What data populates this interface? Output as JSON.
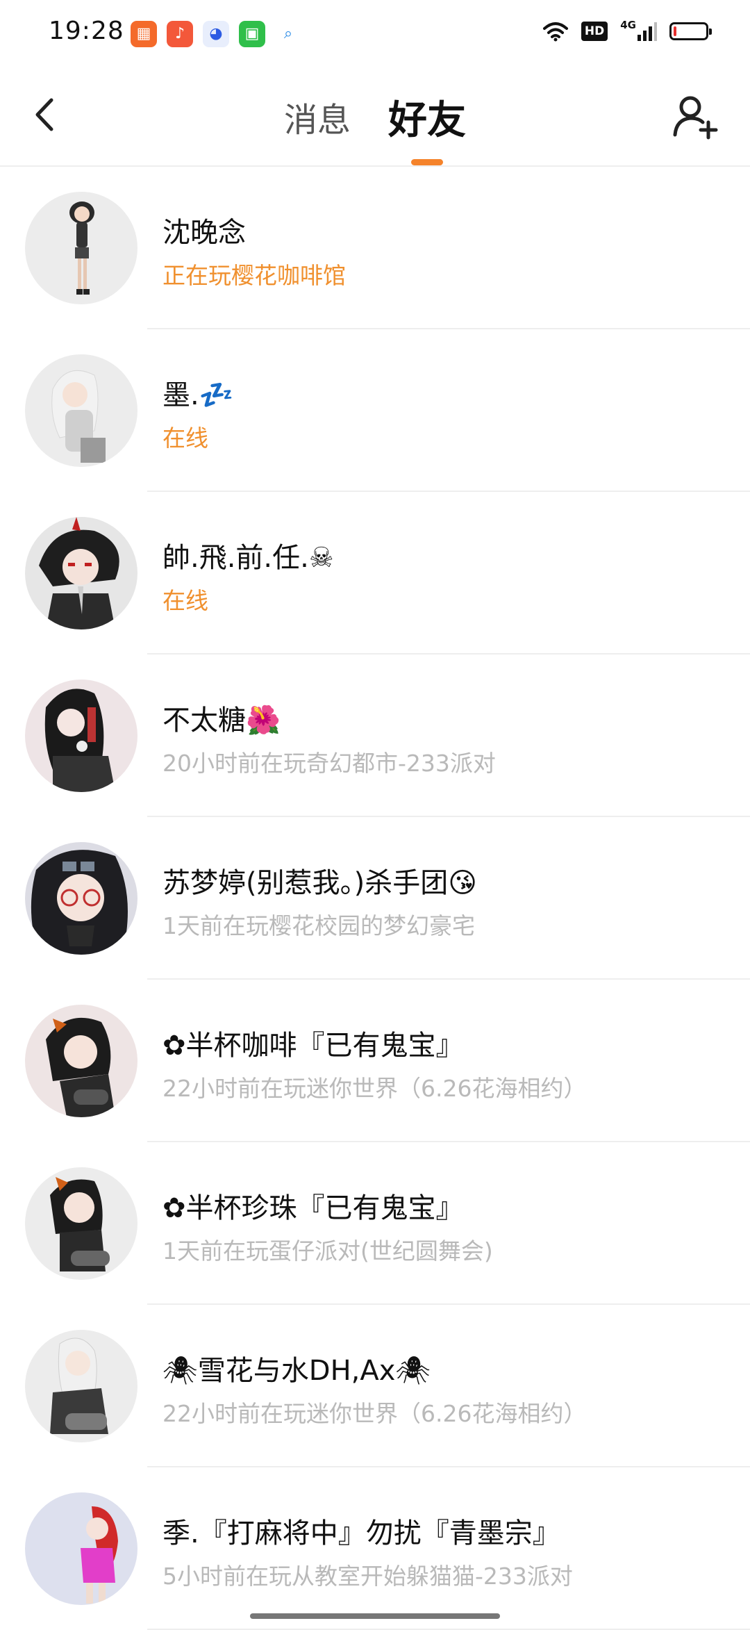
{
  "status_bar": {
    "time": "19:28",
    "hd_label": "HD",
    "net_label": "4G",
    "battery_level": 0.08,
    "battery_color": "#e7302e",
    "notification_apps": [
      "grid-app-icon",
      "music-app-icon",
      "baidu-app-icon",
      "shopping-app-icon",
      "search-app-icon"
    ]
  },
  "header": {
    "tabs": [
      {
        "label": "消息",
        "active": false
      },
      {
        "label": "好友",
        "active": true
      }
    ],
    "accent_color": "#f5832b"
  },
  "friends": [
    {
      "name": "沈晚念",
      "status": "正在玩樱花咖啡馆",
      "online": true,
      "avatar_bg": "#ececec"
    },
    {
      "name": "墨.💤",
      "status": "在线",
      "online": true,
      "avatar_bg": "#ececec"
    },
    {
      "name": "帥.飛.前.任.☠",
      "status": "在线",
      "online": true,
      "avatar_bg": "#e6e6e6"
    },
    {
      "name": "不太糖🌺",
      "status": "20小时前在玩奇幻都市-233派对",
      "online": false,
      "avatar_bg": "#eee4e6"
    },
    {
      "name": "苏梦婷(别惹我。)杀手团😘",
      "status": "1天前在玩樱花校园的梦幻豪宅",
      "online": false,
      "avatar_bg": "#dcdce4"
    },
    {
      "name": "✿半杯咖啡『已有鬼宝』",
      "status": "22小时前在玩迷你世界（6.26花海相约）",
      "online": false,
      "avatar_bg": "#eee4e4"
    },
    {
      "name": "✿半杯珍珠『已有鬼宝』",
      "status": "1天前在玩蛋仔派对(世纪圆舞会)",
      "online": false,
      "avatar_bg": "#ececec"
    },
    {
      "name": "🕷雪花与水DH,Ax🕷",
      "status": "22小时前在玩迷你世界（6.26花海相约）",
      "online": false,
      "avatar_bg": "#ececec"
    },
    {
      "name": "季.『打麻将中』勿扰『青墨宗』",
      "status": "5小时前在玩从教室开始躲猫猫-233派对",
      "online": false,
      "avatar_bg": "#dde0ee"
    }
  ]
}
